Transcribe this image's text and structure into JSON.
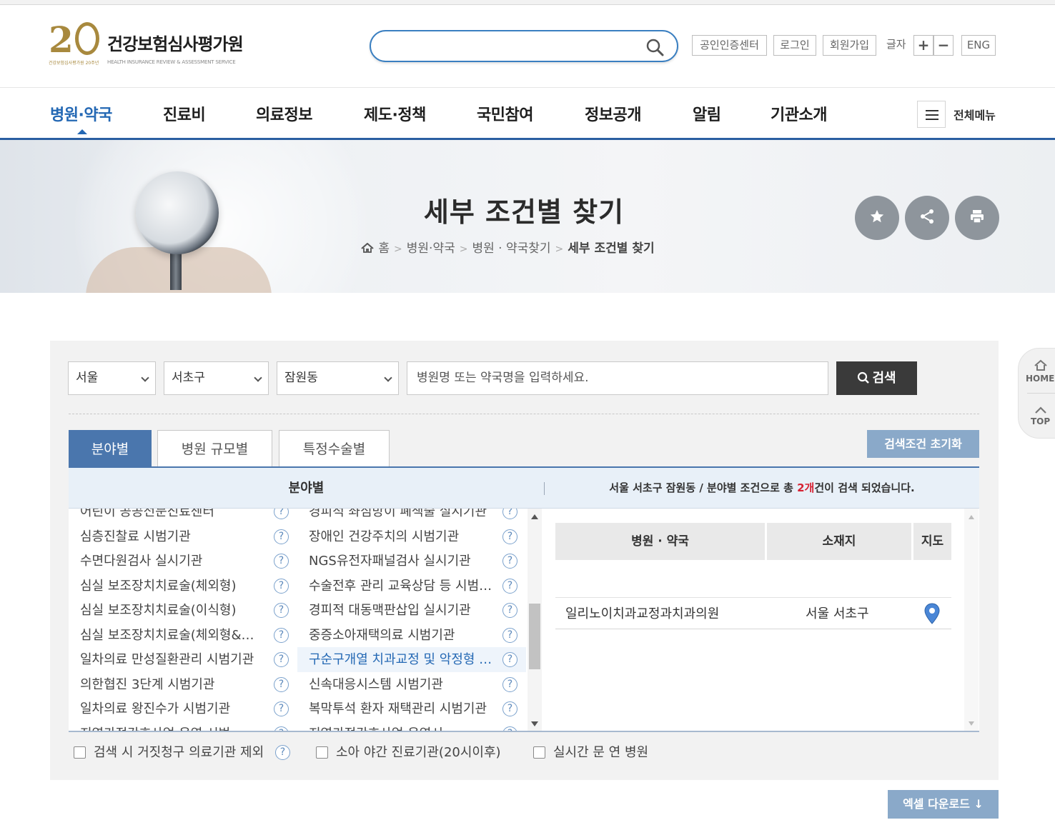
{
  "header": {
    "logo_num": "2",
    "logo_name": "건강보험심사평가원",
    "logo_eng": "HEALTH INSURANCE REVIEW & ASSESSMENT SERVICE",
    "logo_sub": "건강보험심사평가원 20주년",
    "search_placeholder": "",
    "util": {
      "cert": "공인인증센터",
      "login": "로그인",
      "join": "회원가입",
      "fontsize_label": "글자",
      "plus": "+",
      "minus": "−",
      "eng": "ENG"
    }
  },
  "gnb": {
    "items": [
      "병원·약국",
      "진료비",
      "의료정보",
      "제도·정책",
      "국민참여",
      "정보공개",
      "알림",
      "기관소개"
    ],
    "all_menu": "전체메뉴"
  },
  "visual": {
    "title": "세부 조건별 찾기",
    "breadcrumb": [
      "홈",
      "병원·약국",
      "병원 · 약국찾기",
      "세부 조건별 찾기"
    ]
  },
  "search": {
    "sido": "서울",
    "sigungu": "서초구",
    "dong": "잠원동",
    "name_placeholder": "병원명 또는 약국명을 입력하세요.",
    "button": "검색"
  },
  "tabs": [
    "분야별",
    "병원 규모별",
    "특정수술별"
  ],
  "reset_label": "검색조건 초기화",
  "list_header": "분야별",
  "result_summary": {
    "prefix": "서울 서초구 잠원동 / 분야별 조건으로 총 ",
    "count": "2개",
    "suffix": "건이 검색 되었습니다."
  },
  "categories_left": [
    "어린이 공공전문진료센터",
    "심층진찰료 시범기관",
    "수면다원검사 실시기관",
    "심실 보조장치치료술(체외형)",
    "심실 보조장치치료술(이식형)",
    "심실 보조장치치료술(체외형&…",
    "일차의료 만성질환관리 시범기관",
    "의한협진 3단계 시범기관",
    "일차의료 왕진수가 시범기관",
    "지역가정간호사업 운영 시범…"
  ],
  "categories_right": [
    "경피적 좌심방이 폐색술 실시기관",
    "장애인 건강주치의 시범기관",
    "NGS유전자패널검사 실시기관",
    "수술전후 관리 교육상담 등 시범…",
    "경피적 대동맥판삽입 실시기관",
    "중증소아재택의료 시범기관",
    "구순구개열 치과교정 및 악정형 …",
    "신속대응시스템 시범기관",
    "복막투석 환자 재택관리 시범기관",
    "지역가정간호사업 운영시…"
  ],
  "help_glyph": "?",
  "result_table": {
    "headers": [
      "병원 · 약국",
      "소재지",
      "지도"
    ],
    "rows": [
      {
        "name": "일리노이치과교정과치과의원",
        "location": "서울 서초구"
      }
    ]
  },
  "options": {
    "exclude_false_claim": "검색 시 거짓청구 의료기관 제외",
    "night_pediatric": "소아 야간 진료기관(20시이후)",
    "open_now": "실시간 문 연 병원"
  },
  "excel_label": "엑셀 다운로드 ↓",
  "quick": {
    "home": "HOME",
    "top": "TOP"
  },
  "colors": {
    "primary": "#2468b4",
    "tab_active": "#4a76ad",
    "count_red": "#d62233"
  }
}
